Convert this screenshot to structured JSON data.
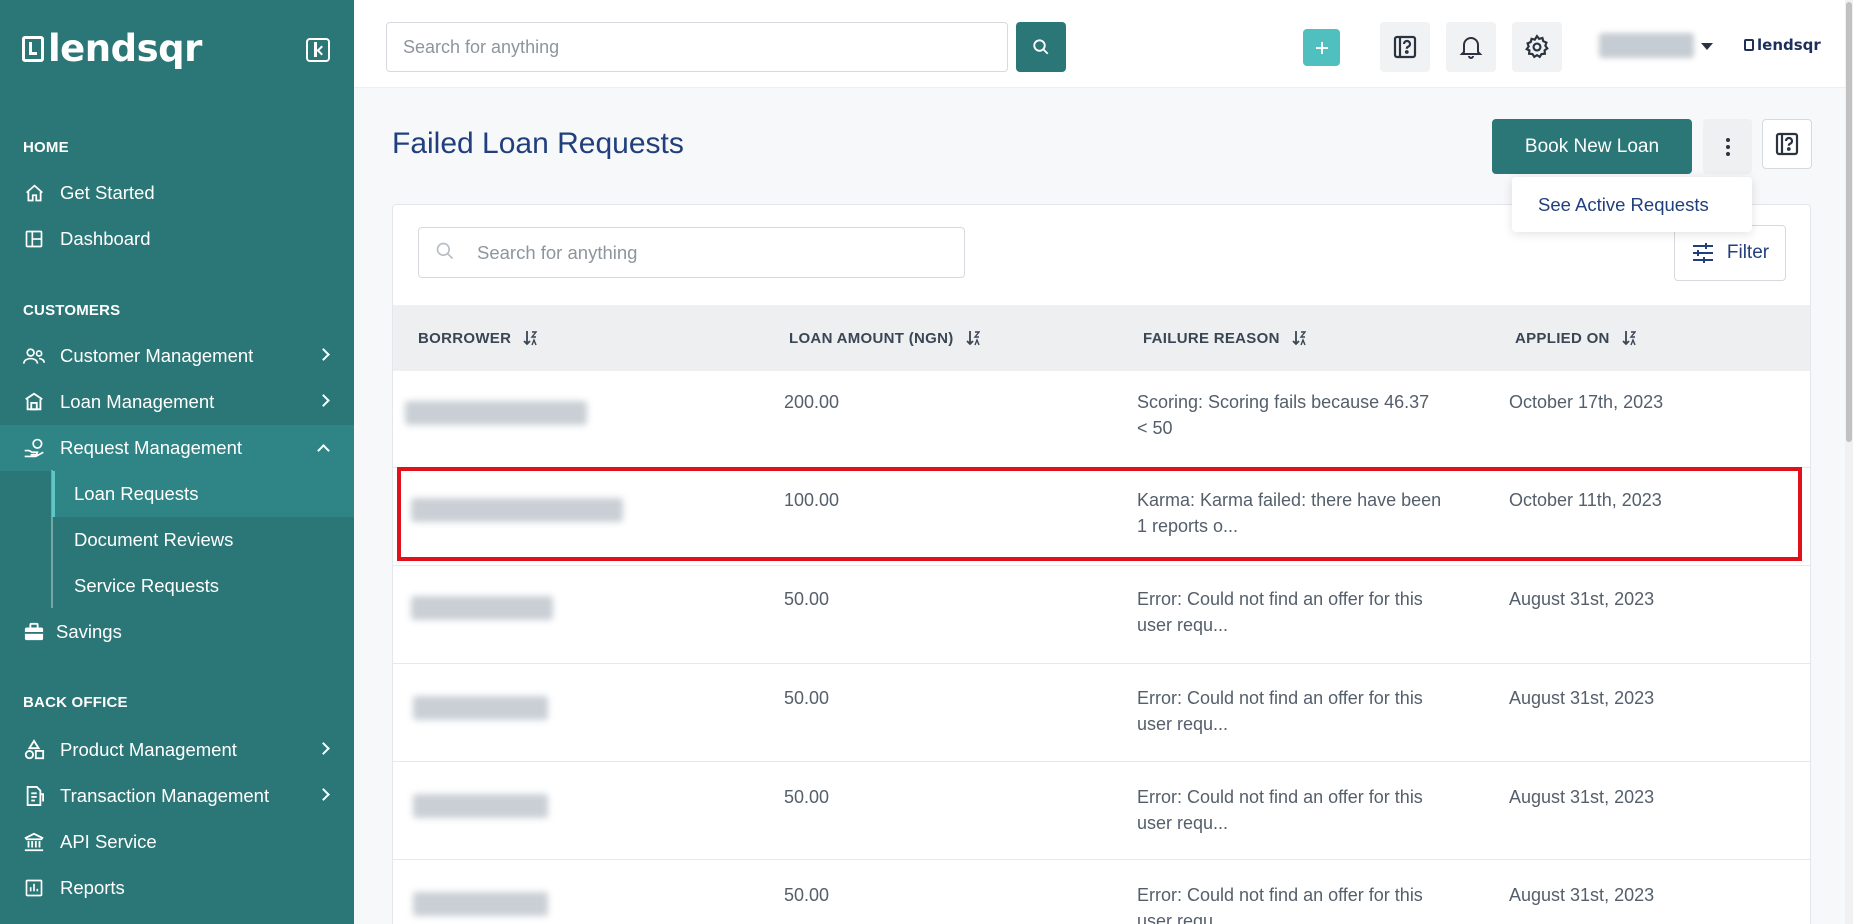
{
  "brand": {
    "name": "lendsqr",
    "small_name": "lendsqr"
  },
  "sidebar": {
    "sections": {
      "home": "HOME",
      "customers": "CUSTOMERS",
      "back_office": "BACK OFFICE"
    },
    "items": {
      "get_started": "Get Started",
      "dashboard": "Dashboard",
      "customer_management": "Customer Management",
      "loan_management": "Loan Management",
      "request_management": "Request Management",
      "loan_requests": "Loan Requests",
      "document_reviews": "Document Reviews",
      "service_requests": "Service Requests",
      "savings": "Savings",
      "product_management": "Product Management",
      "transaction_management": "Transaction Management",
      "api_service": "API Service",
      "reports": "Reports"
    }
  },
  "header": {
    "search_placeholder": "Search for anything"
  },
  "page": {
    "title": "Failed Loan Requests",
    "book_button": "Book New Loan",
    "dropdown_item": "See Active Requests"
  },
  "table": {
    "search_placeholder": "Search for anything",
    "filter_label": "Filter",
    "columns": {
      "borrower": "BORROWER",
      "amount": "LOAN AMOUNT (NGN)",
      "reason": "FAILURE REASON",
      "applied": "APPLIED ON"
    },
    "rows": [
      {
        "amount": "200.00",
        "reason_line1": "Scoring: Scoring fails because 46.37",
        "reason_line2": "< 50",
        "applied": "October 17th, 2023"
      },
      {
        "amount": "100.00",
        "reason_line1": "Karma: Karma failed: there have been",
        "reason_line2": "1 reports o...",
        "applied": "October 11th, 2023"
      },
      {
        "amount": "50.00",
        "reason_line1": "Error: Could not find an offer for this",
        "reason_line2": "user requ...",
        "applied": "August 31st, 2023"
      },
      {
        "amount": "50.00",
        "reason_line1": "Error: Could not find an offer for this",
        "reason_line2": "user requ...",
        "applied": "August 31st, 2023"
      },
      {
        "amount": "50.00",
        "reason_line1": "Error: Could not find an offer for this",
        "reason_line2": "user requ...",
        "applied": "August 31st, 2023"
      },
      {
        "amount": "50.00",
        "reason_line1": "Error: Could not find an offer for this",
        "reason_line2": "user requ...",
        "applied": "August 31st, 2023"
      }
    ]
  },
  "colors": {
    "sidebar": "#2b7676",
    "accent": "#4fc0bf",
    "title": "#213f7d",
    "highlight": "#e0111b"
  }
}
